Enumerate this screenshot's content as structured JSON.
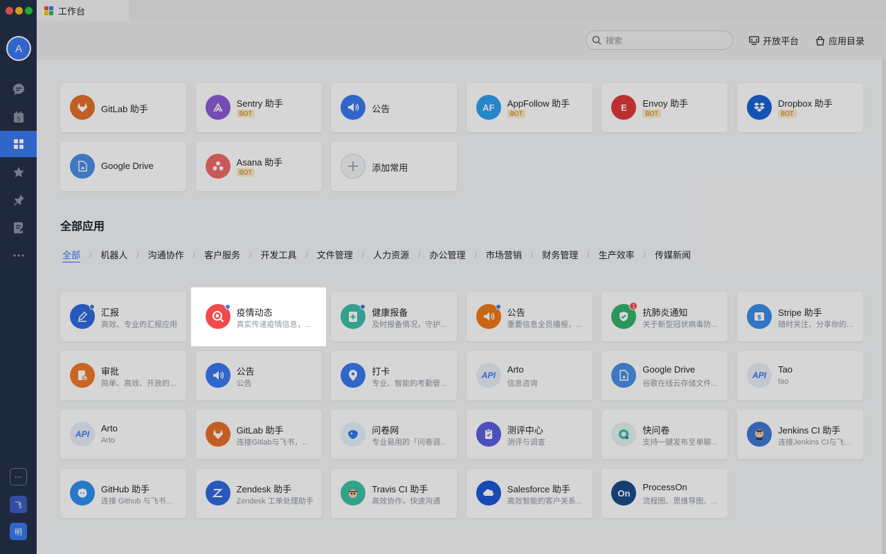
{
  "window": {
    "tab_title": "工作台",
    "logo_colors": [
      "#f05a28",
      "#3a7af0",
      "#ffc107",
      "#2fb16a"
    ]
  },
  "sidebar": {
    "avatar_initial": "A",
    "items": [
      {
        "icon": "chat-icon"
      },
      {
        "icon": "calendar-icon",
        "day": "5"
      },
      {
        "icon": "workplace-icon",
        "active": true
      },
      {
        "icon": "star-icon"
      },
      {
        "icon": "pin-icon"
      },
      {
        "icon": "doc-edit-icon"
      },
      {
        "icon": "more-icon"
      }
    ],
    "bottom": [
      {
        "label": "···"
      },
      {
        "label": "飞"
      },
      {
        "label": "明"
      }
    ]
  },
  "toolbar": {
    "search_placeholder": "搜索",
    "open_platform": "开放平台",
    "app_directory": "应用目录"
  },
  "favorites": [
    {
      "name": "GitLab 助手",
      "icon": "gitlab-icon",
      "color": "#e8702a"
    },
    {
      "name": "Sentry 助手",
      "badge": "BOT",
      "icon": "sentry-icon",
      "color": "#8d5ad6"
    },
    {
      "name": "公告",
      "icon": "announcement-icon",
      "color": "#3a7af0"
    },
    {
      "name": "AppFollow 助手",
      "badge": "BOT",
      "icon": "appfollow-icon",
      "color": "#2f9ff0",
      "text": "AF"
    },
    {
      "name": "Envoy 助手",
      "badge": "BOT",
      "icon": "envoy-icon",
      "color": "#e23a3a",
      "text": "E"
    },
    {
      "name": "Dropbox 助手",
      "badge": "BOT",
      "icon": "dropbox-icon",
      "color": "#1a63d6"
    },
    {
      "name": "Google Drive",
      "icon": "google-drive-icon",
      "color": "#4a8fe8"
    },
    {
      "name": "Asana 助手",
      "badge": "BOT",
      "icon": "asana-icon",
      "color": "#f06a6a"
    },
    {
      "name": "添加常用",
      "icon": "add-icon",
      "color": "#f2f3f5"
    }
  ],
  "all_apps": {
    "title": "全部应用",
    "categories": [
      "全部",
      "机器人",
      "沟通协作",
      "客户服务",
      "开发工具",
      "文件管理",
      "人力资源",
      "办公管理",
      "市场营销",
      "财务管理",
      "生产效率",
      "传媒新闻"
    ],
    "apps": [
      {
        "name": "汇报",
        "desc": "高效、专业的汇报应用",
        "icon": "report-icon",
        "color": "#2f6be0",
        "dot": true
      },
      {
        "name": "疫情动态",
        "desc": "真实传递疫情信息，...",
        "icon": "epidemic-icon",
        "color": "#f04a4a",
        "dot": true,
        "highlight": true
      },
      {
        "name": "健康报备",
        "desc": "及时报备情况，守护...",
        "icon": "health-report-icon",
        "color": "#3dbfa8",
        "dot": true
      },
      {
        "name": "公告",
        "desc": "重要信息全员播报，...",
        "icon": "announcement-icon",
        "color": "#f07a1a",
        "dot": true
      },
      {
        "name": "抗肺炎通知",
        "desc": "关于新型冠状病毒防...",
        "icon": "virus-notice-icon",
        "color": "#34b36a",
        "badge": "1"
      },
      {
        "name": "Stripe 助手",
        "desc": "随时关注、分享你的...",
        "icon": "stripe-icon",
        "color": "#3a8de8"
      },
      {
        "name": "审批",
        "desc": "简单、高效、开放的...",
        "icon": "approval-icon",
        "color": "#f07a2a"
      },
      {
        "name": "公告",
        "desc": "公告",
        "icon": "announcement-icon",
        "color": "#3a7af0"
      },
      {
        "name": "打卡",
        "desc": "专业、智能的考勤管...",
        "icon": "clock-in-icon",
        "color": "#3a7af0"
      },
      {
        "name": "Arto",
        "desc": "信息咨询",
        "icon": "api-icon",
        "color": "#e8eef8",
        "text": "API"
      },
      {
        "name": "Google Drive",
        "desc": "谷歌在线云存储文件...",
        "icon": "google-drive-icon",
        "color": "#4a8fe8"
      },
      {
        "name": "Tao",
        "desc": "tao",
        "icon": "api-icon",
        "color": "#e8eef8",
        "text": "API"
      },
      {
        "name": "Arto",
        "desc": "Arto",
        "icon": "api-icon",
        "color": "#e8eef8",
        "text": "API"
      },
      {
        "name": "GitLab 助手",
        "desc": "连接Gitlab与飞书，...",
        "icon": "gitlab-icon",
        "color": "#e8702a"
      },
      {
        "name": "问卷网",
        "desc": "专业易用的「问卷调...",
        "icon": "wenjuan-icon",
        "color": "#e8f2fd"
      },
      {
        "name": "测评中心",
        "desc": "测评与调查",
        "icon": "assessment-icon",
        "color": "#5b5fe0"
      },
      {
        "name": "快问卷",
        "desc": "支持一键发布至单聊...",
        "icon": "quick-survey-icon",
        "color": "#e4f5ef"
      },
      {
        "name": "Jenkins CI 助手",
        "desc": "连接Jenkins CI与飞...",
        "icon": "jenkins-icon",
        "color": "#3d7bd6"
      },
      {
        "name": "GitHub 助手",
        "desc": "连接 Github 与飞书...",
        "icon": "github-icon",
        "color": "#2f8ff0"
      },
      {
        "name": "Zendesk 助手",
        "desc": "Zendesk 工单处理助手",
        "icon": "zendesk-icon",
        "color": "#2f6be0"
      },
      {
        "name": "Travis CI 助手",
        "desc": "高效协作，快速沟通",
        "icon": "travis-icon",
        "color": "#3ec1a4"
      },
      {
        "name": "Salesforce 助手",
        "desc": "高效智能的客户关系...",
        "icon": "salesforce-icon",
        "color": "#1a5ad6"
      },
      {
        "name": "ProcessOn",
        "desc": "流程图、思维导图、...",
        "icon": "processon-icon",
        "color": "#1a4a8a",
        "text": "On"
      }
    ]
  }
}
